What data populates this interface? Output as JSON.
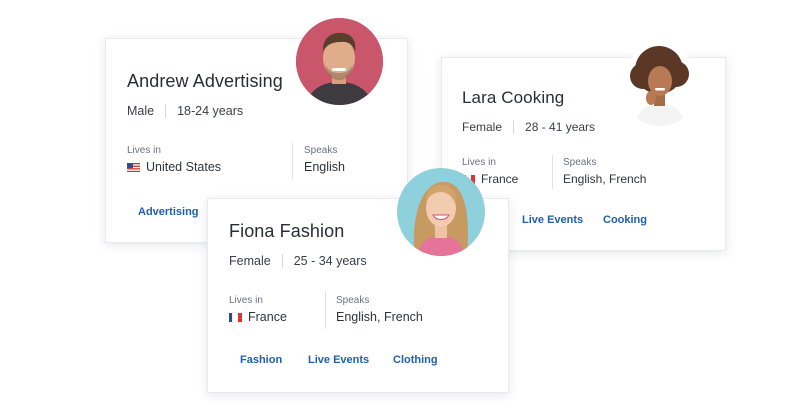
{
  "colors": {
    "tag": "#1e5fae",
    "text": "#2a2e34",
    "muted": "#6b7280"
  },
  "cards": {
    "andrew": {
      "name": "Andrew Advertising",
      "gender": "Male",
      "age": "18-24 years",
      "lives_in_label": "Lives in",
      "lives_in": "United States",
      "speaks_label": "Speaks",
      "speaks": "English",
      "tags": [
        "Advertising"
      ],
      "avatar_icon": "man-portrait-avatar"
    },
    "lara": {
      "name": "Lara Cooking",
      "gender": "Female",
      "age": "28 - 41 years",
      "lives_in_label": "Lives in",
      "lives_in": "France",
      "speaks_label": "Speaks",
      "speaks": "English, French",
      "tags": [
        "Live Events",
        "Cooking"
      ],
      "avatar_icon": "woman-portrait-avatar"
    },
    "fiona": {
      "name": "Fiona Fashion",
      "gender": "Female",
      "age": "25 - 34 years",
      "lives_in_label": "Lives in",
      "lives_in": "France",
      "speaks_label": "Speaks",
      "speaks": "English, French",
      "tags": [
        "Fashion",
        "Live Events",
        "Clothing"
      ],
      "avatar_icon": "woman-portrait-avatar"
    }
  }
}
